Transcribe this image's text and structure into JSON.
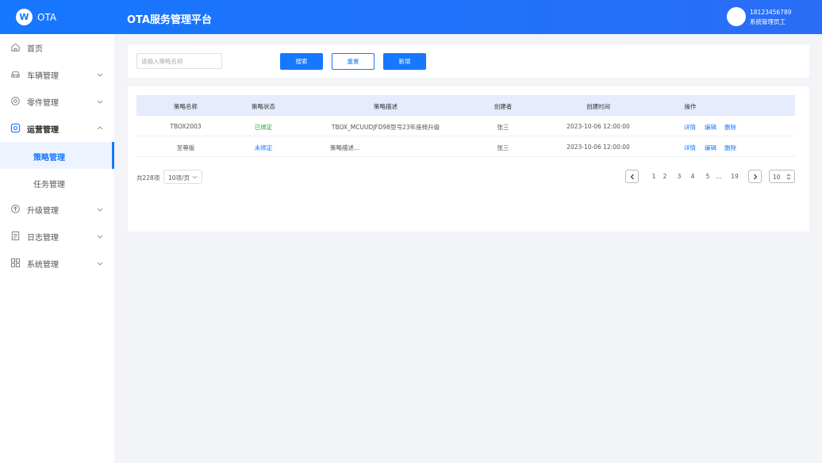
{
  "header": {
    "logo_text": "OTA",
    "app_title": "OTA服务管理平台",
    "user_phone": "18123456789",
    "user_role": "系统管理员工"
  },
  "sidebar": {
    "items": [
      {
        "label": "首页",
        "icon": "home-icon"
      },
      {
        "label": "车辆管理",
        "icon": "car-icon"
      },
      {
        "label": "零件管理",
        "icon": "gear-icon"
      },
      {
        "label": "运营管理",
        "icon": "operation-icon"
      },
      {
        "label": "升级管理",
        "icon": "upgrade-icon"
      },
      {
        "label": "日志管理",
        "icon": "log-icon"
      },
      {
        "label": "系统管理",
        "icon": "grid-icon"
      }
    ],
    "sub_items": [
      {
        "label": "策略管理"
      },
      {
        "label": "任务管理"
      }
    ]
  },
  "search": {
    "placeholder": "请输入策略名称",
    "value": "",
    "search_label": "搜索",
    "reset_label": "重置",
    "add_label": "新增"
  },
  "table": {
    "columns": [
      "策略名称",
      "策略状态",
      "策略描述",
      "创建者",
      "创建时间",
      "操作"
    ],
    "rows": [
      {
        "name": "TBOX2003",
        "status": "已绑定",
        "desc": "TBOX_MCUUDJFD98型号23年座椅升级",
        "creator": "张三",
        "time": "2023-10-06 12:00:00"
      },
      {
        "name": "至尊版",
        "status": "未绑定",
        "desc": "策略描述...",
        "creator": "张三",
        "time": "2023-10-06 12:00:00"
      }
    ],
    "actions": [
      "详情",
      "编辑",
      "删除"
    ]
  },
  "pagination": {
    "total": "共228项",
    "page_size": "10项/页",
    "pages": [
      "1",
      "2",
      "3",
      "4",
      "5",
      "...",
      "19"
    ],
    "jump_value": "10"
  },
  "colors": {
    "primary": "#1677ff",
    "bound": "#2ba245",
    "header_row": "#e6ecfd"
  }
}
